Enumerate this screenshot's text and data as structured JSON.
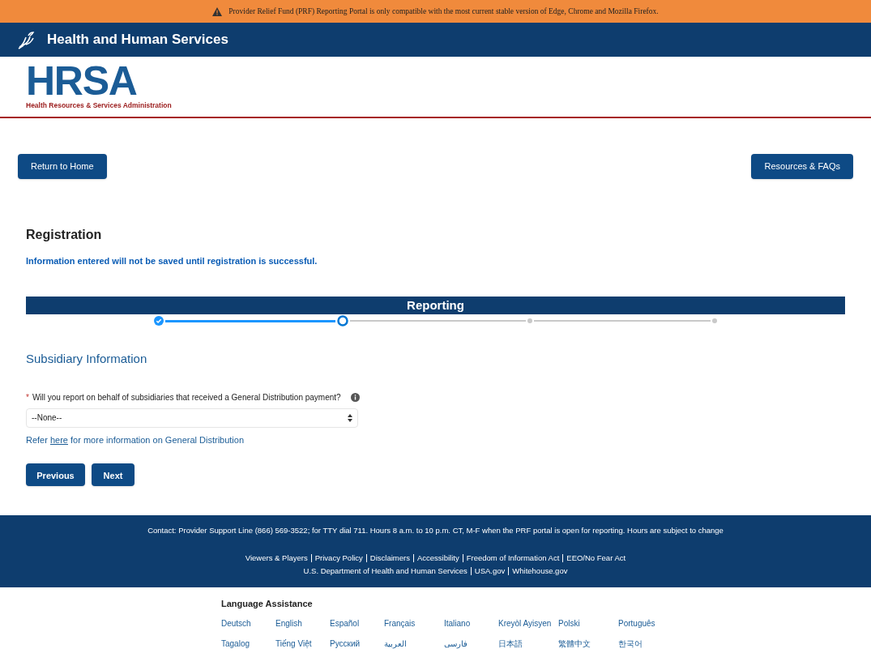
{
  "alert_banner": {
    "text": "Provider Relief Fund (PRF) Reporting Portal is only compatible with the most current stable version of Edge, Chrome and Mozilla Firefox."
  },
  "header": {
    "title": "Health and Human Services"
  },
  "logo": {
    "name": "HRSA",
    "subtitle": "Health Resources & Services Administration"
  },
  "nav_buttons": [
    "Return to Home",
    "Resources & FAQs"
  ],
  "page": {
    "title": "Registration",
    "notice": "Information entered will not be saved until registration is successful."
  },
  "progress": {
    "title": "Reporting",
    "steps": [
      {
        "kind": "done"
      },
      {
        "kind": "current"
      },
      {
        "kind": "todo"
      },
      {
        "kind": "todo"
      }
    ]
  },
  "section": {
    "title": "Subsidiary Information",
    "question": {
      "required_mark": "*",
      "label": "Will you report on behalf of subsidiaries that received a General Distribution payment?",
      "value": "--None--"
    },
    "refer": {
      "before": "Refer",
      "link": "here",
      "after": "for more information on General Distribution"
    }
  },
  "form_buttons": [
    "Previous",
    "Next"
  ],
  "footer": {
    "contact": "Contact: Provider Support Line (866) 569-3522; for TTY dial 711. Hours 8 a.m. to 10 p.m. CT, M-F when the PRF portal is open for reporting. Hours are subject to change",
    "links_row_1": [
      "Viewers & Players",
      "Privacy Policy",
      "Disclaimers",
      "Accessibility",
      "Freedom of Information Act",
      "EEO/No Fear Act"
    ],
    "links_row_2": [
      "U.S. Department of Health and Human Services",
      "USA.gov",
      "Whitehouse.gov"
    ]
  },
  "language_assistance": {
    "title": "Language Assistance",
    "languages": [
      "Deutsch",
      "English",
      "Español",
      "Français",
      "Italiano",
      "Kreyòl Ayisyen",
      "Polski",
      "Português",
      "Tagalog",
      "Tiếng Việt",
      "Русский",
      "العربية",
      "فارسی",
      "日本語",
      "繁體中文",
      "한국어"
    ]
  }
}
